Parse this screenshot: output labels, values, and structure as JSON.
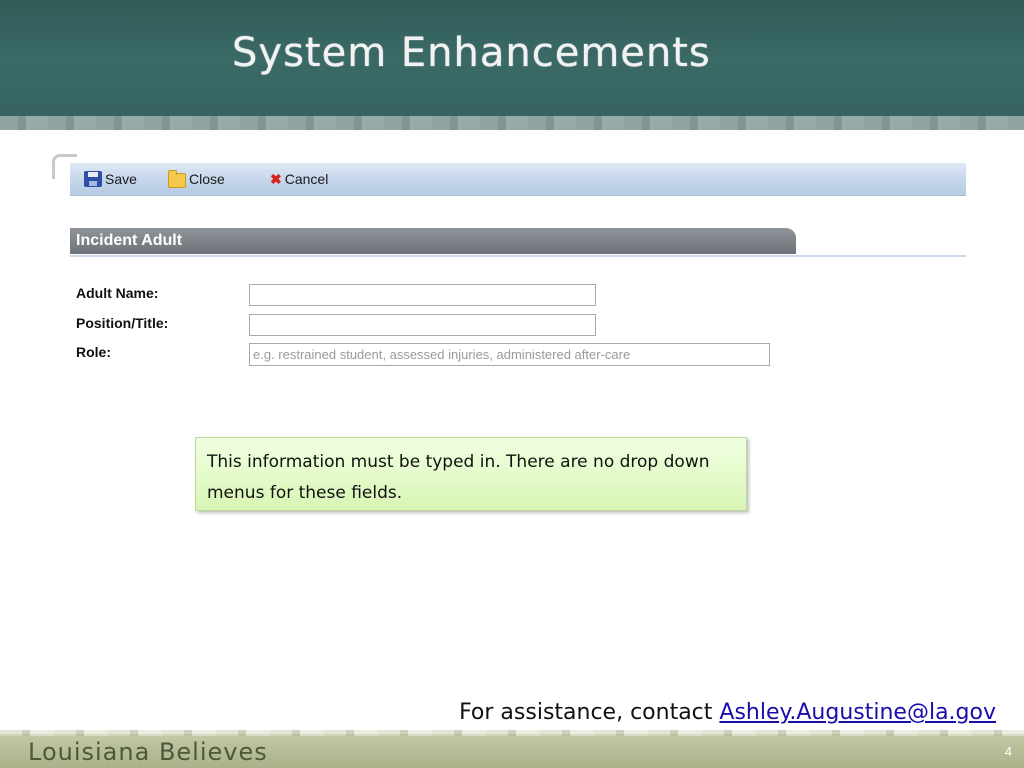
{
  "slide": {
    "title": "System Enhancements",
    "footer_brand": "Louisiana Believes",
    "page_number": "4"
  },
  "toolbar": {
    "save_label": "Save",
    "close_label": "Close",
    "cancel_label": "Cancel"
  },
  "form": {
    "section_title": "Incident Adult",
    "fields": [
      {
        "label": "Adult Name:",
        "value": "",
        "placeholder": ""
      },
      {
        "label": "Position/Title:",
        "value": "",
        "placeholder": ""
      },
      {
        "label": "Role:",
        "value": "",
        "placeholder": "e.g. restrained student, assessed injuries, administered after-care"
      }
    ]
  },
  "callout": {
    "text": "This information must be typed in. There are no drop down menus for these fields."
  },
  "assistance": {
    "prefix": "For assistance, contact ",
    "email": "Ashley.Augustine@la.gov"
  },
  "colors": {
    "banner": "#35625e",
    "callout_bg": "#d8f6b5",
    "link": "#1a0dab"
  }
}
